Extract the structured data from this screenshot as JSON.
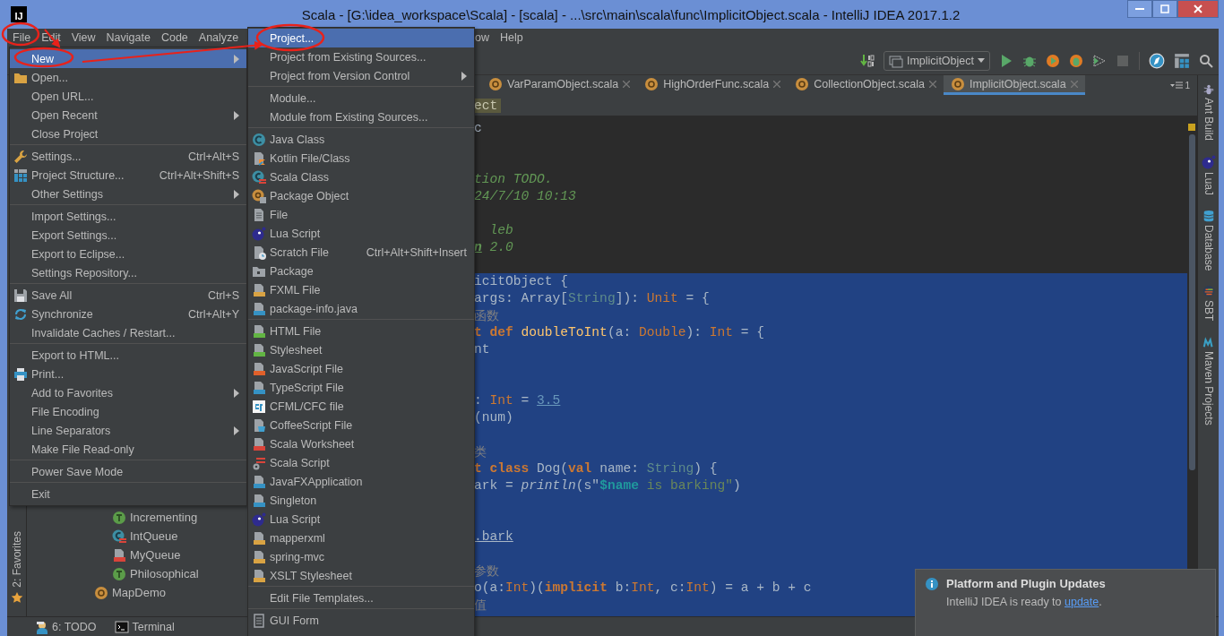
{
  "window": {
    "logo": "IJ",
    "title": "Scala - [G:\\idea_workspace\\Scala] - [scala] - ...\\src\\main\\scala\\func\\ImplicitObject.scala - IntelliJ IDEA 2017.1.2"
  },
  "menu_bar": [
    "File",
    "Edit",
    "View",
    "Navigate",
    "Code",
    "Analyze"
  ],
  "menu_bar_after_submenu": [
    "ow",
    "Help"
  ],
  "run_configuration": "ImplicitObject",
  "tabs": [
    {
      "label": "VarParamObject.scala",
      "selected": false
    },
    {
      "label": "HighOrderFunc.scala",
      "selected": false
    },
    {
      "label": "CollectionObject.scala",
      "selected": false
    },
    {
      "label": "ImplicitObject.scala",
      "selected": true
    }
  ],
  "tab_list_count": "1",
  "breadcrumb": [
    "ect"
  ],
  "code_lines": [
    {
      "selected": false,
      "tokens": [
        {
          "kind": "plain",
          "text": "c"
        }
      ]
    },
    {
      "kind": "blank"
    },
    {
      "kind": "blank"
    },
    {
      "selected": false,
      "tokens": [
        {
          "kind": "comment",
          "text": "tion TODO."
        }
      ]
    },
    {
      "selected": false,
      "tokens": [
        {
          "kind": "comment",
          "text": "24/7/10 10:13"
        }
      ]
    },
    {
      "kind": "blank"
    },
    {
      "selected": false,
      "tokens": [
        {
          "kind": "comment",
          "text": "  leb"
        }
      ]
    },
    {
      "selected": false,
      "tokens": [
        {
          "kind": "doc-tag",
          "text": "n",
          "underlined": true
        },
        {
          "kind": "comment",
          "text": " 2.0"
        }
      ]
    },
    {
      "kind": "blank"
    },
    {
      "selected": true,
      "tokens": [
        {
          "kind": "plain",
          "text": "icitObject {"
        }
      ]
    },
    {
      "selected": true,
      "tokens": [
        {
          "kind": "plain",
          "text": "args: Array["
        },
        {
          "kind": "type2",
          "text": "String"
        },
        {
          "kind": "plain",
          "text": "]): "
        },
        {
          "kind": "type",
          "text": "Unit"
        },
        {
          "kind": "plain",
          "text": " = {"
        }
      ]
    },
    {
      "selected": true,
      "tokens": [
        {
          "kind": "cjk",
          "text": "函数"
        }
      ]
    },
    {
      "selected": true,
      "tokens": [
        {
          "kind": "keyword",
          "text": "t def "
        },
        {
          "kind": "function",
          "text": "doubleToInt"
        },
        {
          "kind": "plain",
          "text": "(a: "
        },
        {
          "kind": "type",
          "text": "Double"
        },
        {
          "kind": "plain",
          "text": "): "
        },
        {
          "kind": "type",
          "text": "Int"
        },
        {
          "kind": "plain",
          "text": " = {"
        }
      ]
    },
    {
      "selected": true,
      "tokens": [
        {
          "kind": "plain",
          "text": "nt"
        }
      ]
    },
    {
      "selected": true
    },
    {
      "selected": true
    },
    {
      "selected": true,
      "tokens": [
        {
          "kind": "plain",
          "text": ": "
        },
        {
          "kind": "type",
          "text": "Int"
        },
        {
          "kind": "plain",
          "text": " = "
        },
        {
          "kind": "number",
          "text": "3.5",
          "underlined": true
        }
      ]
    },
    {
      "selected": true,
      "tokens": [
        {
          "kind": "plain",
          "text": "(num)"
        }
      ]
    },
    {
      "selected": true
    },
    {
      "selected": true,
      "tokens": [
        {
          "kind": "cjk",
          "text": "类"
        }
      ]
    },
    {
      "selected": true,
      "tokens": [
        {
          "kind": "keyword",
          "text": "t class"
        },
        {
          "kind": "plain",
          "text": " Dog("
        },
        {
          "kind": "keyword",
          "text": "val"
        },
        {
          "kind": "plain",
          "text": " name: "
        },
        {
          "kind": "type2",
          "text": "String"
        },
        {
          "kind": "plain",
          "text": ") {"
        }
      ]
    },
    {
      "selected": true,
      "tokens": [
        {
          "kind": "plain",
          "text": "ark = "
        },
        {
          "kind": "call",
          "text": "println"
        },
        {
          "kind": "plain",
          "text": "(s\""
        },
        {
          "kind": "interp",
          "text": "$name"
        },
        {
          "kind": "string",
          "text": " is barking\""
        },
        {
          "kind": "plain",
          "text": ")"
        }
      ]
    },
    {
      "selected": true
    },
    {
      "selected": true
    },
    {
      "selected": true,
      "tokens": [
        {
          "kind": "plain",
          "text": ".bark",
          "underlined": true
        }
      ]
    },
    {
      "selected": true
    },
    {
      "selected": true,
      "tokens": [
        {
          "kind": "cjk",
          "text": "参数"
        }
      ]
    },
    {
      "selected": true,
      "tokens": [
        {
          "kind": "plain",
          "text": "o(a:"
        },
        {
          "kind": "type",
          "text": "Int"
        },
        {
          "kind": "plain",
          "text": ")("
        },
        {
          "kind": "keyword",
          "text": "implicit"
        },
        {
          "kind": "plain",
          "text": " b:"
        },
        {
          "kind": "type",
          "text": "Int"
        },
        {
          "kind": "plain",
          "text": ", c:"
        },
        {
          "kind": "type",
          "text": "Int"
        },
        {
          "kind": "plain",
          "text": ") = a + b + c"
        }
      ]
    },
    {
      "selected": true,
      "tokens": [
        {
          "kind": "cjk",
          "text": "值"
        }
      ]
    },
    {
      "selected": true
    }
  ],
  "file_menu": [
    {
      "kind": "item",
      "label": "New",
      "submenu": true,
      "selected": true
    },
    {
      "kind": "folder",
      "label": "Open...",
      "selected": false
    },
    {
      "kind": "item",
      "label": "Open URL...",
      "selected": false
    },
    {
      "kind": "item",
      "label": "Open Recent",
      "submenu": true,
      "selected": false
    },
    {
      "kind": "item",
      "label": "Close Project",
      "selected": false
    },
    {
      "kind": "separator"
    },
    {
      "kind": "wrench",
      "label": "Settings...",
      "shortcut": "Ctrl+Alt+S",
      "selected": false
    },
    {
      "kind": "structure",
      "label": "Project Structure...",
      "shortcut": "Ctrl+Alt+Shift+S",
      "selected": false
    },
    {
      "kind": "item",
      "label": "Other Settings",
      "submenu": true,
      "selected": false
    },
    {
      "kind": "separator"
    },
    {
      "kind": "item",
      "label": "Import Settings...",
      "selected": false
    },
    {
      "kind": "item",
      "label": "Export Settings...",
      "selected": false
    },
    {
      "kind": "item",
      "label": "Export to Eclipse...",
      "selected": false
    },
    {
      "kind": "item",
      "label": "Settings Repository...",
      "selected": false
    },
    {
      "kind": "separator"
    },
    {
      "kind": "disk",
      "label": "Save All",
      "shortcut": "Ctrl+S",
      "selected": false
    },
    {
      "kind": "sync",
      "label": "Synchronize",
      "shortcut": "Ctrl+Alt+Y",
      "selected": false
    },
    {
      "kind": "item",
      "label": "Invalidate Caches / Restart...",
      "selected": false
    },
    {
      "kind": "separator"
    },
    {
      "kind": "item",
      "label": "Export to HTML...",
      "selected": false
    },
    {
      "kind": "printer",
      "label": "Print...",
      "selected": false
    },
    {
      "kind": "item",
      "label": "Add to Favorites",
      "submenu": true,
      "selected": false
    },
    {
      "kind": "item",
      "label": "File Encoding",
      "selected": false
    },
    {
      "kind": "item",
      "label": "Line Separators",
      "submenu": true,
      "selected": false
    },
    {
      "kind": "item",
      "label": "Make File Read-only",
      "selected": false
    },
    {
      "kind": "separator"
    },
    {
      "kind": "item",
      "label": "Power Save Mode",
      "selected": false
    },
    {
      "kind": "separator"
    },
    {
      "kind": "item",
      "label": "Exit",
      "selected": false
    }
  ],
  "new_submenu": [
    {
      "kind": "item",
      "label": "Project...",
      "selected": true
    },
    {
      "kind": "item",
      "label": "Project from Existing Sources...",
      "selected": false
    },
    {
      "kind": "item",
      "label": "Project from Version Control",
      "submenu": true,
      "selected": false
    },
    {
      "kind": "separator"
    },
    {
      "kind": "item",
      "label": "Module...",
      "selected": false
    },
    {
      "kind": "item",
      "label": "Module from Existing Sources...",
      "selected": false
    },
    {
      "kind": "separator"
    },
    {
      "kind": "class",
      "label": "Java Class",
      "selected": false
    },
    {
      "kind": "kotlin",
      "label": "Kotlin File/Class",
      "selected": false
    },
    {
      "kind": "scala-class",
      "label": "Scala Class",
      "selected": false
    },
    {
      "kind": "package-object",
      "label": "Package Object",
      "selected": false
    },
    {
      "kind": "file",
      "label": "File",
      "selected": false
    },
    {
      "kind": "lua",
      "label": "Lua Script",
      "selected": false
    },
    {
      "kind": "scratch",
      "label": "Scratch File",
      "shortcut": "Ctrl+Alt+Shift+Insert",
      "selected": false
    },
    {
      "kind": "package",
      "label": "Package",
      "selected": false
    },
    {
      "kind": "xml-doc",
      "label": "FXML File",
      "selected": false
    },
    {
      "kind": "java-doc",
      "label": "package-info.java",
      "selected": false
    },
    {
      "kind": "separator"
    },
    {
      "kind": "html-doc",
      "label": "HTML File",
      "selected": false
    },
    {
      "kind": "css-doc",
      "label": "Stylesheet",
      "selected": false
    },
    {
      "kind": "js-doc",
      "label": "JavaScript File",
      "selected": false
    },
    {
      "kind": "ts-doc",
      "label": "TypeScript File",
      "selected": false
    },
    {
      "kind": "cfml",
      "label": "CFML/CFC file",
      "selected": false
    },
    {
      "kind": "coffee",
      "label": "CoffeeScript File",
      "selected": false
    },
    {
      "kind": "worksheet-doc",
      "label": "Scala Worksheet",
      "selected": false
    },
    {
      "kind": "scala-script",
      "label": "Scala Script",
      "selected": false
    },
    {
      "kind": "java-doc",
      "label": "JavaFXApplication",
      "selected": false
    },
    {
      "kind": "java-doc",
      "label": "Singleton",
      "selected": false
    },
    {
      "kind": "lua",
      "label": "Lua Script",
      "selected": false
    },
    {
      "kind": "xml-doc",
      "label": "mapperxml",
      "selected": false
    },
    {
      "kind": "xml-doc",
      "label": "spring-mvc",
      "selected": false
    },
    {
      "kind": "xml-doc",
      "label": "XSLT Stylesheet",
      "selected": false
    },
    {
      "kind": "separator"
    },
    {
      "kind": "item",
      "label": "Edit File Templates...",
      "selected": false
    },
    {
      "kind": "separator"
    },
    {
      "kind": "gui-form",
      "label": "GUI Form",
      "selected": false
    }
  ],
  "project_tree": [
    {
      "children": [
        {
          "label": "Incrementing",
          "kind": "trait"
        },
        {
          "label": "IntQueue",
          "kind": "scala-class"
        },
        {
          "label": "MyQueue",
          "kind": "worksheet-doc"
        },
        {
          "label": "Philosophical",
          "kind": "trait"
        }
      ]
    },
    {
      "label": "MapDemo",
      "kind": "object"
    }
  ],
  "left_tool_strip": [
    "2: Favorites"
  ],
  "right_tool_strip": [
    {
      "label": "Ant Build",
      "kind": "ant"
    },
    {
      "label": "LuaJ",
      "kind": "lua"
    },
    {
      "label": "Database",
      "kind": "database"
    },
    {
      "label": "SBT",
      "kind": "sbt"
    },
    {
      "label": "Maven Projects",
      "kind": "maven"
    }
  ],
  "bottom_bar": [
    {
      "label": "6: TODO",
      "kind": "todo"
    },
    {
      "label": "Terminal",
      "kind": "terminal"
    }
  ],
  "notification": {
    "title": "Platform and Plugin Updates",
    "text": "IntelliJ IDEA is ready to ",
    "link": "update",
    "after": "."
  }
}
